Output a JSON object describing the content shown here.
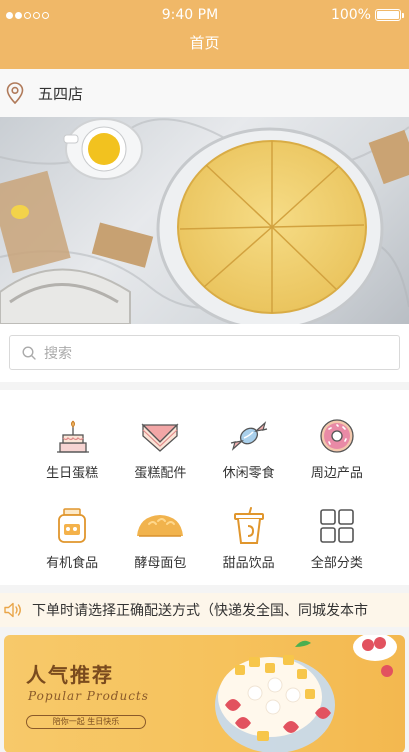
{
  "status_bar": {
    "time": "9:40 PM",
    "battery": "100%"
  },
  "header": {
    "title": "首页"
  },
  "location": {
    "store_name": "五四店"
  },
  "search": {
    "placeholder": "搜索"
  },
  "categories": [
    {
      "label": "生日蛋糕",
      "icon": "birthday-cake-icon"
    },
    {
      "label": "蛋糕配件",
      "icon": "cake-slice-icon"
    },
    {
      "label": "休闲零食",
      "icon": "candy-icon"
    },
    {
      "label": "周边产品",
      "icon": "donut-icon"
    },
    {
      "label": "有机食品",
      "icon": "jar-icon"
    },
    {
      "label": "酵母面包",
      "icon": "bread-icon"
    },
    {
      "label": "甜品饮品",
      "icon": "drink-cup-icon"
    },
    {
      "label": "全部分类",
      "icon": "grid-icon"
    }
  ],
  "notice": {
    "text": "下单时请选择正确配送方式（快递发全国、同城发本市"
  },
  "promo": {
    "title": "人气推荐",
    "subtitle": "Popular Products",
    "tag": "陪你一起 生日快乐"
  },
  "colors": {
    "header_bg": "#f0b868",
    "accent": "#e9a548",
    "notice_bg": "#fdf6ea"
  }
}
